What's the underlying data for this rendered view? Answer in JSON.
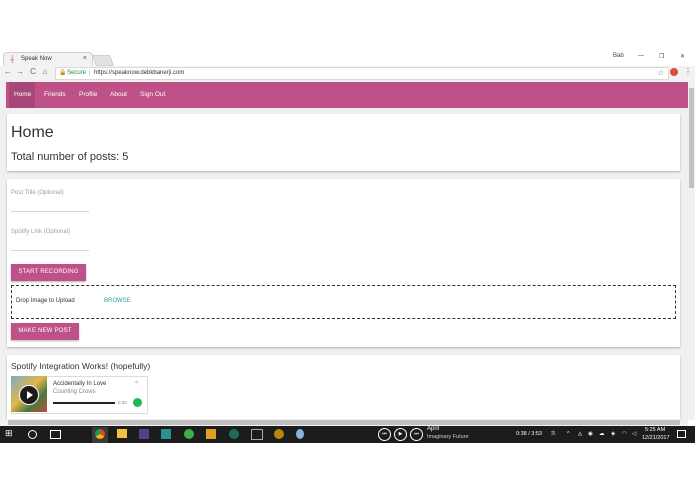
{
  "browser": {
    "tab_title": "Speak Now",
    "tab_close": "×",
    "window_user": "Bab",
    "window_min": "—",
    "window_max": "❐",
    "window_close": "✕",
    "secure_label": "Secure",
    "url": "https://speaknow.debkbanerji.com",
    "back": "←",
    "forward": "→",
    "reload": "C",
    "home": "⌂"
  },
  "nav": {
    "items": [
      {
        "label": "Home"
      },
      {
        "label": "Friends"
      },
      {
        "label": "Profile"
      },
      {
        "label": "About"
      },
      {
        "label": "Sign Out"
      }
    ],
    "active": "Home"
  },
  "home_card": {
    "title": "Home",
    "subtitle": "Total number of posts: 5"
  },
  "new_post": {
    "post_title_placeholder": "Post Title (Optional)",
    "spotify_link_placeholder": "Spotify Link (Optional)",
    "start_recording_label": "START RECORDING",
    "drop_label": "Drop Image to Upload",
    "browse_label": "BROWSE",
    "make_post_label": "MAKE NEW POST"
  },
  "post": {
    "title": "Spotify Integration Works! (hopefully)",
    "track": "Accidentally In Love",
    "artist": "Counting Crows",
    "time": "0:30",
    "progress": 1.0
  },
  "taskbar": {
    "media_title": "April",
    "media_artist": "Imaginary Future",
    "media_time": "0:38 / 3:53",
    "clock_time": "5:25 AM",
    "clock_date": "12/21/2017"
  },
  "colors": {
    "brand": "#bf5189",
    "browse": "#26a69a",
    "spotify": "#1db954"
  }
}
